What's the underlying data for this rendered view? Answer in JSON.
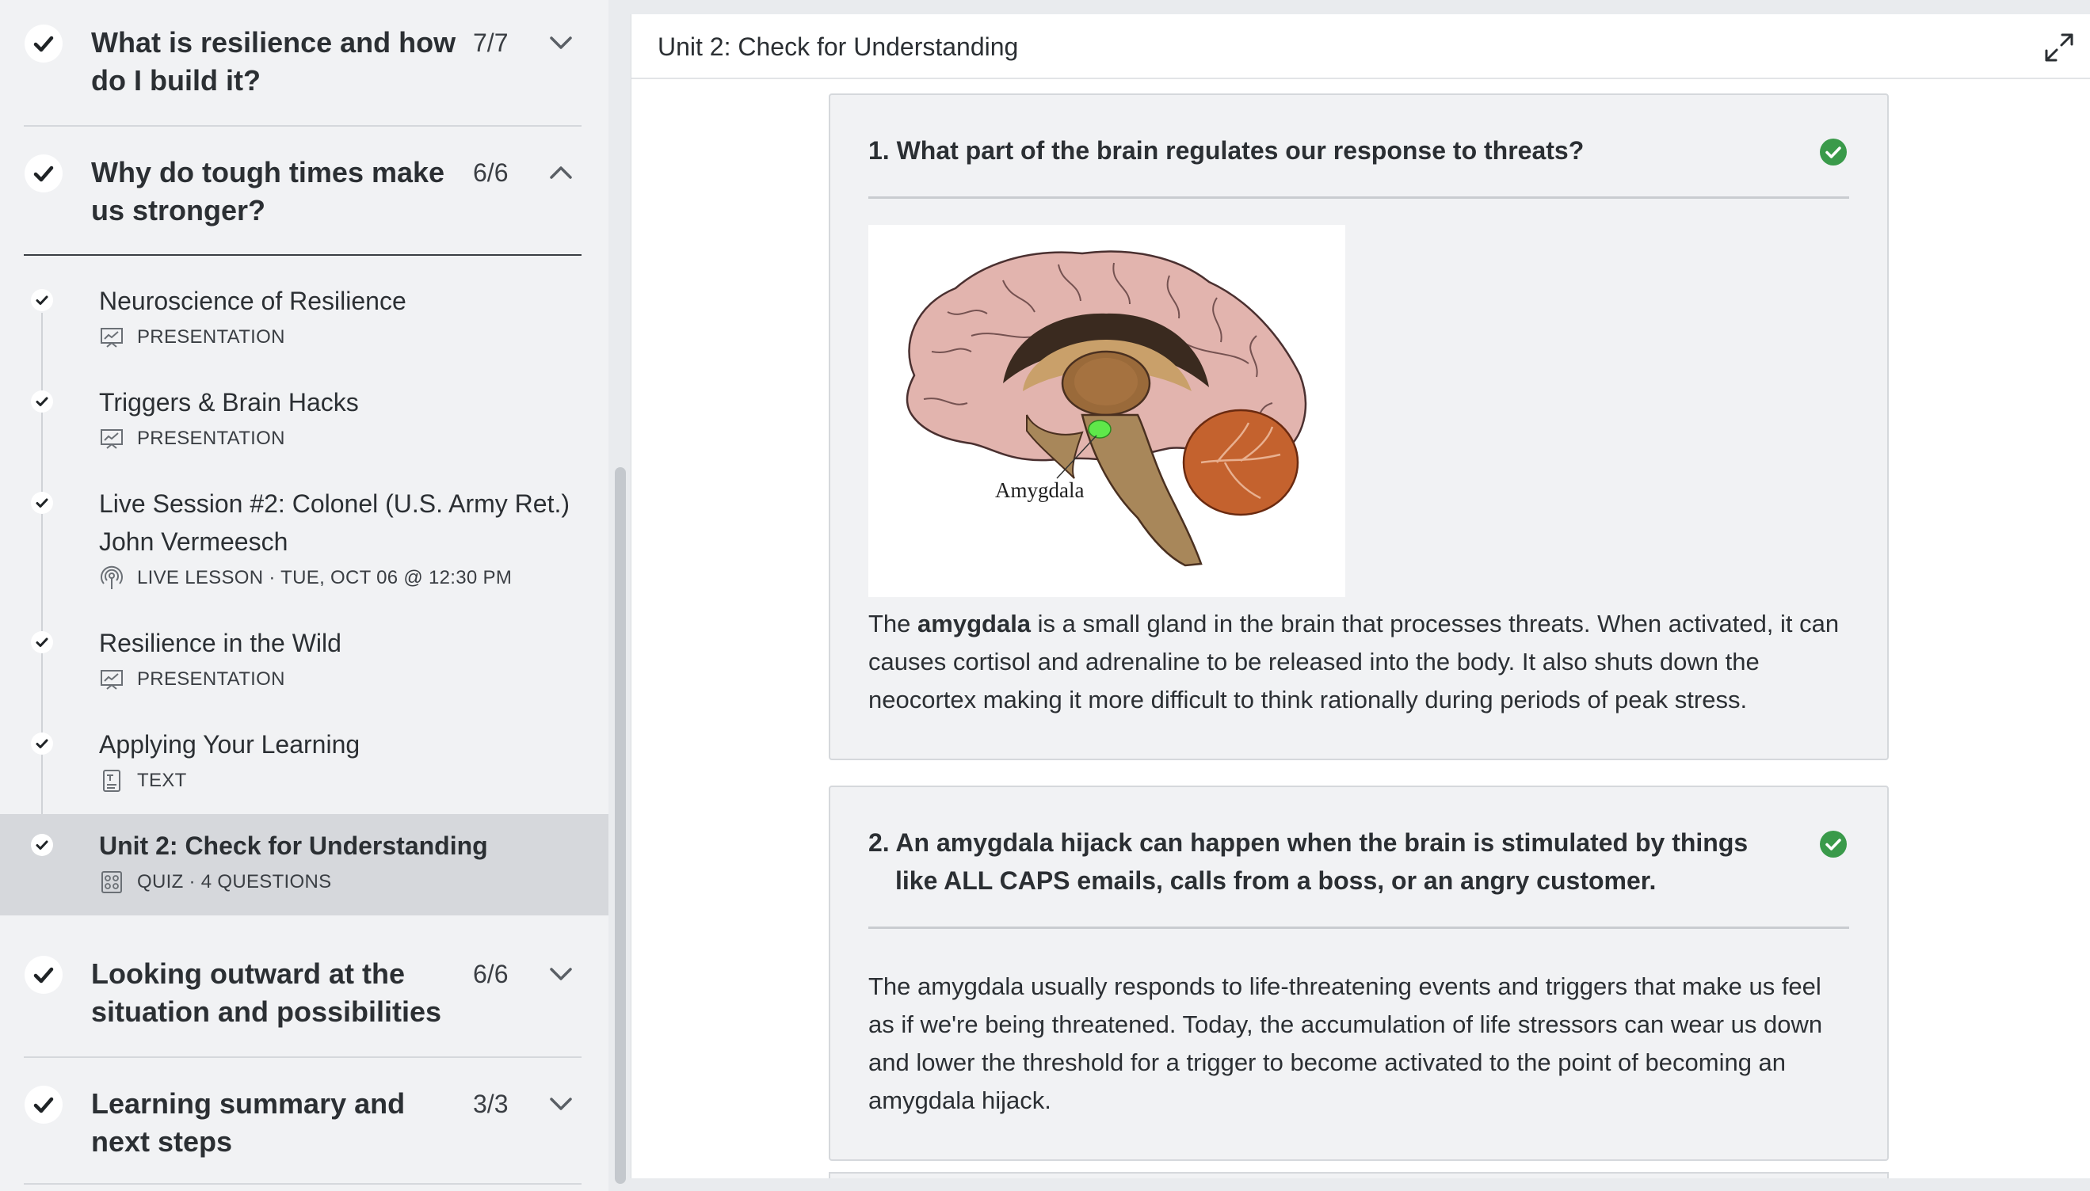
{
  "sidebar": {
    "topics": [
      {
        "title": "What is resilience and how do I build it?",
        "count": "7/7",
        "expanded": false
      },
      {
        "title": "Why do tough times make us stronger?",
        "count": "6/6",
        "expanded": true
      },
      {
        "title": "Looking outward at the situation and possibilities",
        "count": "6/6",
        "expanded": false
      },
      {
        "title": "Learning summary and next steps",
        "count": "3/3",
        "expanded": false
      }
    ],
    "lessons": [
      {
        "title": "Neuroscience of Resilience",
        "meta": "PRESENTATION",
        "icon": "presentation-icon"
      },
      {
        "title": "Triggers & Brain Hacks",
        "meta": "PRESENTATION",
        "icon": "presentation-icon"
      },
      {
        "title": "Live Session #2: Colonel (U.S. Army Ret.) John Vermeesch",
        "meta": "LIVE LESSON · TUE, OCT 06 @ 12:30 PM",
        "icon": "broadcast-icon"
      },
      {
        "title": "Resilience in the Wild",
        "meta": "PRESENTATION",
        "icon": "presentation-icon"
      },
      {
        "title": "Applying Your Learning",
        "meta": "TEXT",
        "icon": "text-document-icon"
      },
      {
        "title": "Unit 2: Check for Understanding",
        "meta": "QUIZ · 4 QUESTIONS",
        "icon": "quiz-icon",
        "active": true
      }
    ]
  },
  "main": {
    "title": "Unit 2: Check for Understanding",
    "questions": [
      {
        "title": "1. What part of the brain regulates our response to threats?",
        "image_label": "Amygdala",
        "text_before": "The ",
        "text_bold": "amygdala",
        "text_after": " is a small gland in the brain that processes threats. When activated, it can causes cortisol and adrenaline to be released into the body. It also shuts down the neocortex making it more difficult to think rationally during periods of peak stress."
      },
      {
        "title": "2. An amygdala hijack can happen when the brain is stimulated by things like ALL CAPS emails, calls from a boss, or an angry customer.",
        "text": "The amygdala usually responds to life-threatening events and triggers that make us feel as if we're being threatened. Today, the accumulation of life stressors can wear us down and lower the threshold for a trigger to become activated to the point of becoming an amygdala hijack."
      }
    ]
  },
  "colors": {
    "success": "#3a9a4a",
    "active_row": "#d6d8dc",
    "card_bg": "#f1f2f4"
  }
}
